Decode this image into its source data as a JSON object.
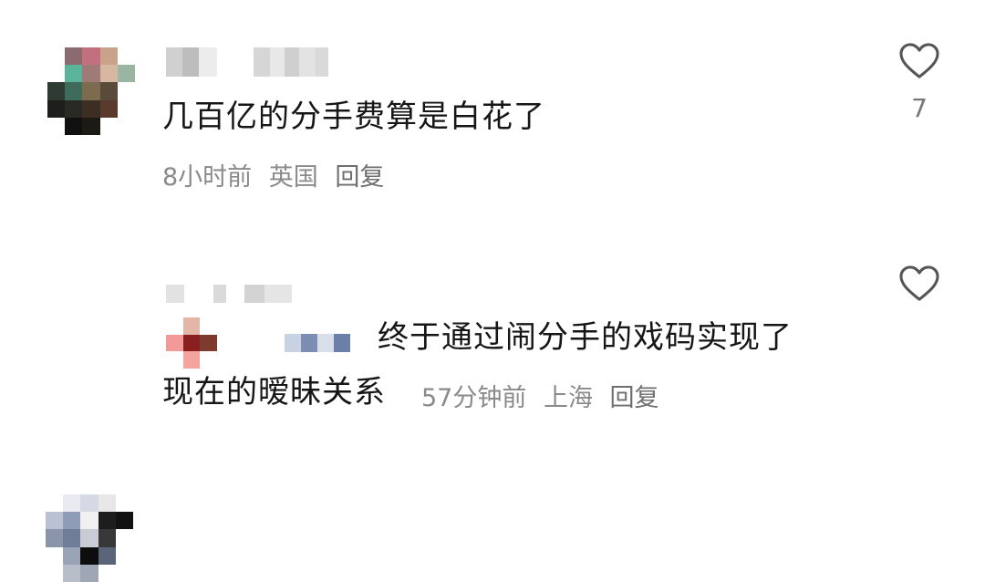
{
  "comments": [
    {
      "text": "几百亿的分手费算是白花了",
      "time": "8小时前",
      "location": "英国",
      "reply_label": "回复",
      "likes": "7"
    },
    {
      "text_line1": "终于通过闹分手的戏码实现了",
      "text_line2": "现在的暧昧关系",
      "time": "57分钟前",
      "location": "上海",
      "reply_label": "回复"
    }
  ],
  "icons": {
    "like": "heart-outline-icon"
  },
  "colors": {
    "text": "#161616",
    "meta": "#8a8a8a",
    "icon": "#555555"
  }
}
